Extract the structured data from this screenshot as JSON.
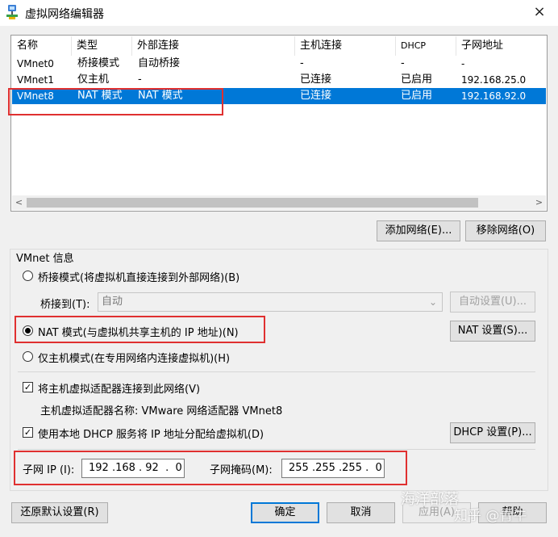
{
  "window": {
    "title": "虚拟网络编辑器",
    "close_icon": "×"
  },
  "table": {
    "headers": [
      "名称",
      "类型",
      "外部连接",
      "主机连接",
      "DHCP",
      "子网地址"
    ],
    "rows": [
      [
        "VMnet0",
        "桥接模式",
        "自动桥接",
        "-",
        "-",
        "-"
      ],
      [
        "VMnet1",
        "仅主机",
        "-",
        "已连接",
        "已启用",
        "192.168.25.0"
      ],
      [
        "VMnet8",
        "NAT 模式",
        "NAT 模式",
        "已连接",
        "已启用",
        "192.168.92.0"
      ]
    ],
    "selected_row": 2,
    "scroll_left": "<",
    "scroll_right": ">"
  },
  "buttons": {
    "add_network": "添加网络(E)...",
    "remove_network": "移除网络(O)",
    "auto_settings": "自动设置(U)...",
    "nat_settings": "NAT 设置(S)...",
    "dhcp_settings": "DHCP 设置(P)...",
    "restore_defaults": "还原默认设置(R)",
    "ok": "确定",
    "cancel": "取消",
    "apply": "应用(A)",
    "help": "帮助"
  },
  "vmnet_info": {
    "group_title": "VMnet 信息",
    "bridged_label": "桥接模式(将虚拟机直接连接到外部网络)(B)",
    "bridged_to_label": "桥接到(T):",
    "bridged_to_value": "自动",
    "nat_label": "NAT 模式(与虚拟机共享主机的 IP 地址)(N)",
    "hostonly_label": "仅主机模式(在专用网络内连接虚拟机)(H)",
    "selected_mode": "nat",
    "connect_adapter_label": "将主机虚拟适配器连接到此网络(V)",
    "connect_adapter_checked": true,
    "adapter_name_text": "主机虚拟适配器名称: VMware 网络适配器 VMnet8",
    "use_dhcp_label": "使用本地 DHCP 服务将 IP 地址分配给虚拟机(D)",
    "use_dhcp_checked": true,
    "subnet_ip_label": "子网 IP (I):",
    "subnet_ip_value": "192 .168 . 92  .  0",
    "subnet_mask_label": "子网掩码(M):",
    "subnet_mask_value": "255 .255 .255 .  0"
  },
  "watermark": {
    "line1": "海洋部落",
    "line2": "知乎 @青牛"
  },
  "colors": {
    "selection": "#0078d7",
    "highlight_box": "#e03030"
  }
}
